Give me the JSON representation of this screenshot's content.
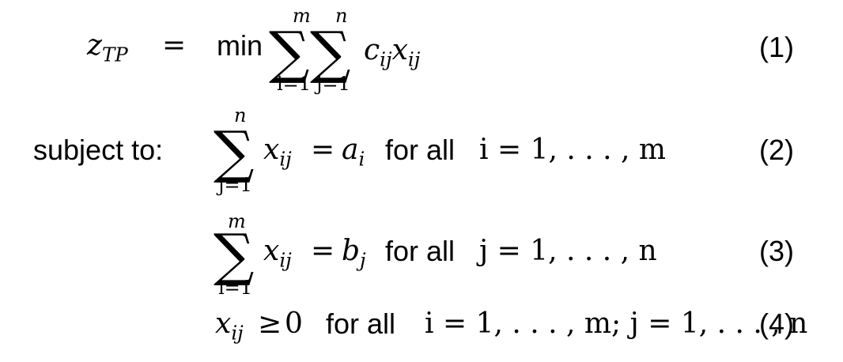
{
  "row1": {
    "lhs_base": "z",
    "lhs_sub": "TP",
    "equals": "=",
    "min": "min",
    "sum1": {
      "symbol": "∑",
      "upper": "m",
      "lower": "i=1"
    },
    "sum2": {
      "symbol": "∑",
      "upper": "n",
      "lower": "j=1"
    },
    "term": {
      "c": "c",
      "c_sub": "ij",
      "x": "x",
      "x_sub": "ij"
    },
    "number": "(1)"
  },
  "row2": {
    "label": "subject to:",
    "sum": {
      "symbol": "∑",
      "upper": "n",
      "lower": "j=1"
    },
    "term": {
      "x": "x",
      "x_sub": "ij"
    },
    "equals": "=",
    "rhs": {
      "base": "a",
      "sub": "i"
    },
    "forall": "for all",
    "range": "i = 1, . . . , m",
    "number": "(2)"
  },
  "row3": {
    "sum": {
      "symbol": "∑",
      "upper": "m",
      "lower": "i=1"
    },
    "term": {
      "x": "x",
      "x_sub": "ij"
    },
    "equals": "=",
    "rhs": {
      "base": "b",
      "sub": "j"
    },
    "forall": "for all",
    "range": "j = 1, . . . , n",
    "number": "(3)"
  },
  "row4": {
    "lhs": {
      "base": "x",
      "sub": "ij"
    },
    "ineq": "≥",
    "zero": "0",
    "forall": "for all",
    "range": "i = 1, . . . , m; j = 1, . . . , n",
    "number": "(4)"
  }
}
